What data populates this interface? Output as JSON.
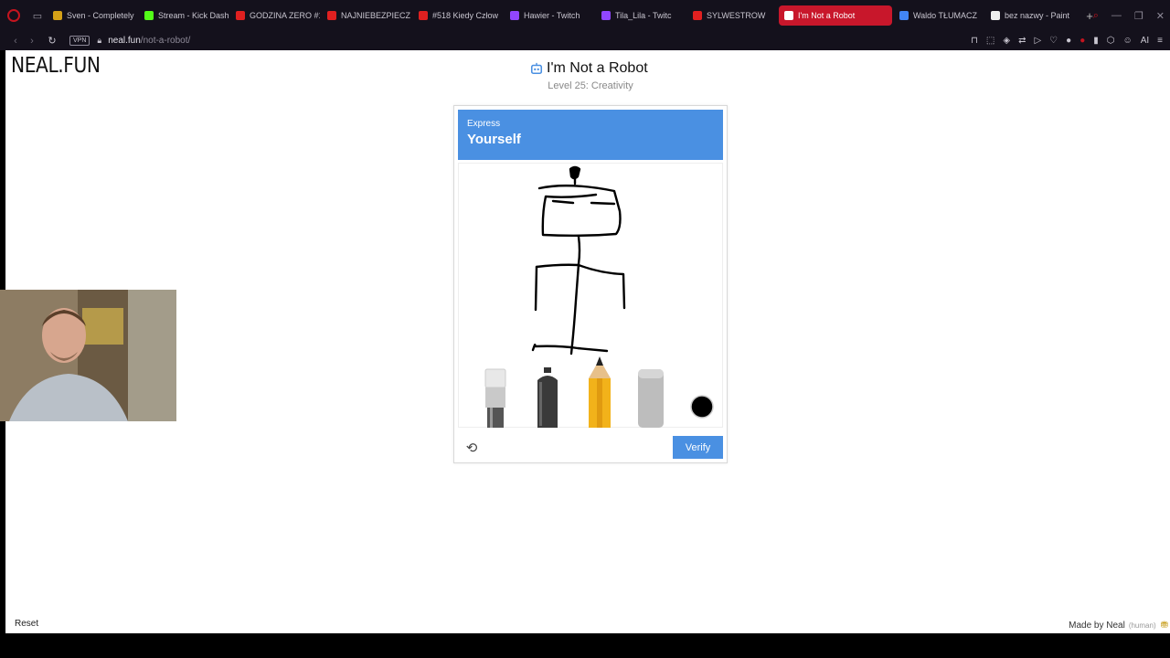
{
  "browser": {
    "tabs": [
      {
        "label": "Sven - Completely",
        "color": "#d4a017",
        "active": false
      },
      {
        "label": "Stream - Kick Dash",
        "color": "#53fc18",
        "active": false
      },
      {
        "label": "GODZINA ZERO #1",
        "color": "#e02020",
        "active": false
      },
      {
        "label": "NAJNIEBEZPIECZ",
        "color": "#e02020",
        "active": false
      },
      {
        "label": "#518 Kiedy Człow",
        "color": "#e02020",
        "active": false
      },
      {
        "label": "Hawier - Twitch",
        "color": "#9146ff",
        "active": false
      },
      {
        "label": "Tila_Lila - Twitc",
        "color": "#9146ff",
        "active": false
      },
      {
        "label": "SYLWESTROW",
        "color": "#e02020",
        "active": false
      },
      {
        "label": "I'm Not a Robot",
        "color": "#ffffff",
        "active": true
      },
      {
        "label": "Waldo TŁUMACZ",
        "color": "#4285f4",
        "active": false
      },
      {
        "label": "bez nazwy - Paint",
        "color": "#eeeeee",
        "active": false
      }
    ],
    "new_tab": "+",
    "vpn_badge": "VPN",
    "url_host": "neal.fun",
    "url_path": "/not-a-robot/"
  },
  "page": {
    "logo": "NEAL.FUN",
    "title": "I'm Not a Robot",
    "subtitle": "Level 25: Creativity",
    "captcha": {
      "header_small": "Express",
      "header_big": "Yourself",
      "tools": [
        "paintbrush-tool",
        "spray-can-tool",
        "pencil-tool",
        "eraser-tool",
        "color-picker"
      ],
      "selected_color": "#000000",
      "verify_label": "Verify"
    },
    "reset_label": "Reset",
    "made_by": "Made by Neal",
    "made_by_tag": "(human)"
  },
  "colors": {
    "accent": "#4a90e2",
    "active_tab": "#c8172b",
    "chrome_bg": "#14111c"
  }
}
